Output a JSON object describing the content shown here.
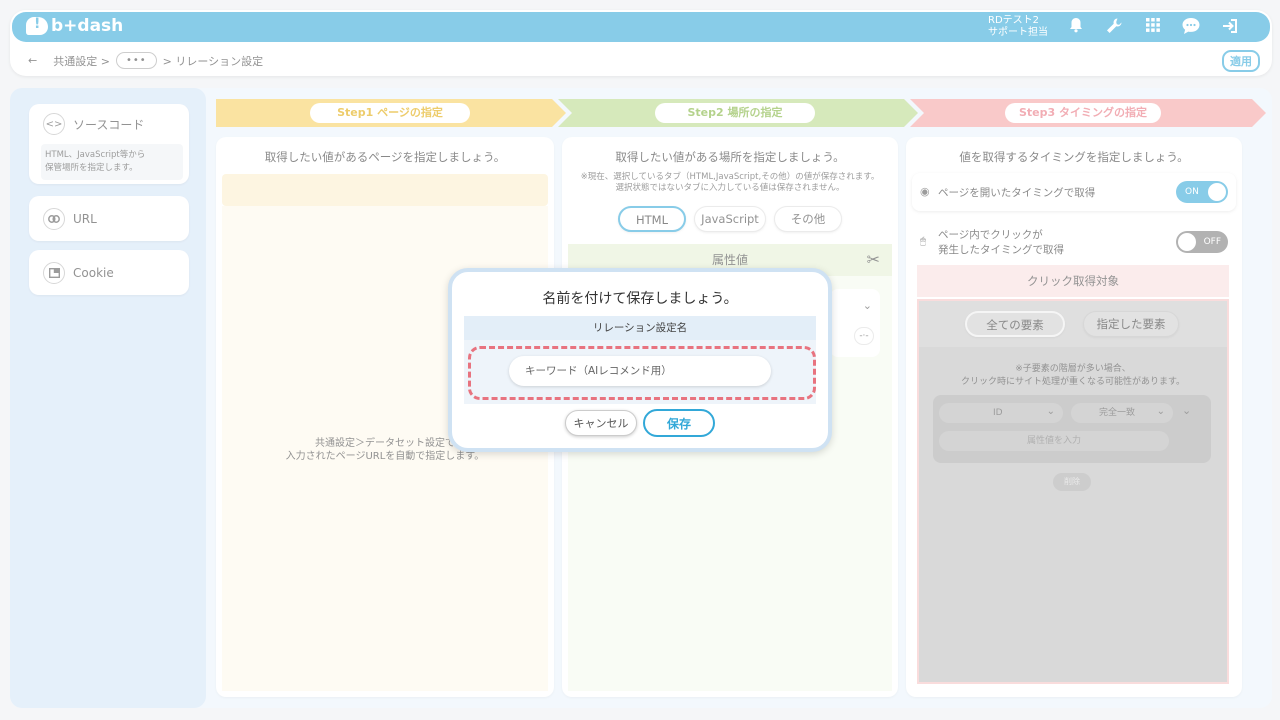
{
  "app": {
    "logo_text": "b+dash"
  },
  "user": {
    "line1": "RDテスト2",
    "line2": "サポート担当"
  },
  "topbar_icons": [
    "bell-icon",
    "wrench-icon",
    "grid-icon",
    "chat-icon",
    "logout-icon"
  ],
  "breadcrumb": {
    "back": "←",
    "item1": "共通設定 >",
    "more": "•••",
    "item3": "> リレーション設定"
  },
  "apply_label": "適用",
  "sidebar": {
    "items": [
      {
        "label": "ソースコード",
        "icon": "code-icon",
        "desc_line1": "HTML、JavaScript等から",
        "desc_line2": "保管場所を指定します。"
      },
      {
        "label": "URL",
        "icon": "link-icon"
      },
      {
        "label": "Cookie",
        "icon": "window-icon"
      }
    ]
  },
  "steps": [
    {
      "label": "Step1 ページの指定"
    },
    {
      "label": "Step2 場所の指定"
    },
    {
      "label": "Step3 タイミングの指定"
    }
  ],
  "step1": {
    "title": "取得したい値があるページを指定しましょう。",
    "note_line1": "共通設定＞データセット設定で",
    "note_line2": "入力されたページURLを自動で指定します。"
  },
  "step2": {
    "title": "取得したい値がある場所を指定しましょう。",
    "note_line1": "※現在、選択しているタブ（HTML,JavaScript,その他）の値が保存されます。",
    "note_line2": "選択状態ではないタブに入力している値は保存されません。",
    "tabs": [
      "HTML",
      "JavaScript",
      "その他"
    ],
    "attr_header": "属性値"
  },
  "step3": {
    "title": "値を取得するタイミングを指定しましょう。",
    "opt1": "ページを開いたタイミングで取得",
    "opt1_toggle": "ON",
    "opt2_line1": "ページ内でクリックが",
    "opt2_line2": "発生したタイミングで取得",
    "opt2_toggle": "OFF",
    "click_target_header": "クリック取得対象",
    "target_buttons": [
      "全ての要素",
      "指定した要素"
    ],
    "note_line1": "※子要素の階層が多い場合、",
    "note_line2": "クリック時にサイト処理が重くなる可能性があります。",
    "select1": "ID",
    "select2": "完全一致",
    "attr_placeholder": "属性値を入力",
    "delete_label": "削除"
  },
  "modal": {
    "title": "名前を付けて保存しましょう。",
    "field_label": "リレーション設定名",
    "input_placeholder": "キーワード（AIレコメンド用）",
    "input_value": "",
    "cancel_label": "キャンセル",
    "save_label": "保存"
  },
  "colors": {
    "brand": "#32a8d8",
    "step1": "#f6cf5e",
    "step2": "#b9d98a",
    "step3": "#f4a3a3",
    "highlight": "#e8737f"
  }
}
